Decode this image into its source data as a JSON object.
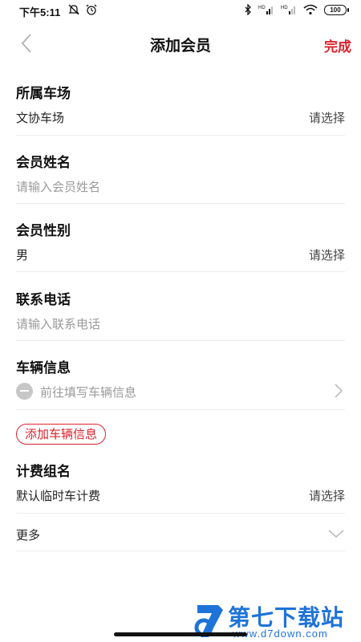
{
  "status_bar": {
    "time": "下午5:11",
    "battery": "100",
    "icons": [
      "mute-icon",
      "alarm-icon",
      "bluetooth-icon",
      "hd-signal-icon",
      "hd-signal-icon",
      "wifi-icon",
      "battery-icon"
    ]
  },
  "header": {
    "title": "添加会员",
    "done_label": "完成"
  },
  "form": {
    "parking_lot": {
      "label": "所属车场",
      "value": "文协车场",
      "select_hint": "请选择"
    },
    "member_name": {
      "label": "会员姓名",
      "placeholder": "请输入会员姓名"
    },
    "member_gender": {
      "label": "会员性别",
      "value": "男",
      "select_hint": "请选择"
    },
    "phone": {
      "label": "联系电话",
      "placeholder": "请输入联系电话"
    },
    "vehicle": {
      "label": "车辆信息",
      "placeholder": "前往填写车辆信息"
    },
    "add_vehicle_label": "添加车辆信息",
    "billing_group": {
      "label": "计费组名",
      "value": "默认临时车计费",
      "select_hint": "请选择"
    },
    "more_label": "更多"
  },
  "watermark": {
    "title": "第七下载站",
    "url": "www.d7down.com"
  },
  "colors": {
    "accent": "#d9232d",
    "placeholder": "#9a9a9a",
    "divider": "#ececec",
    "watermark": "#1e73d8"
  }
}
